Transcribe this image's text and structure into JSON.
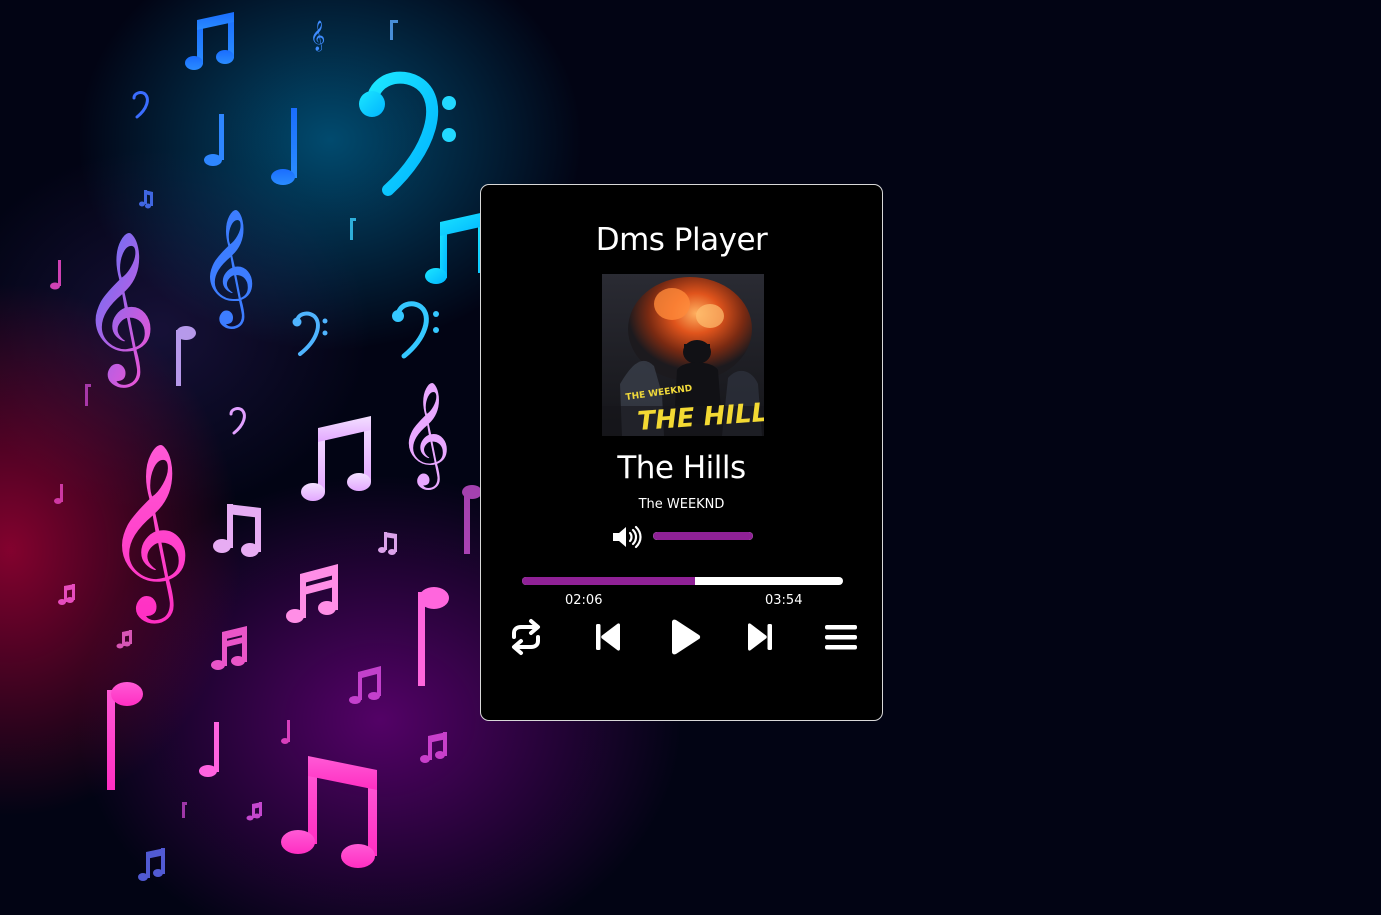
{
  "app": {
    "title": "Dms Player"
  },
  "track": {
    "title": "The Hills",
    "artist": "The WEEKND",
    "cover_text_top": "THE WEEKND",
    "cover_text_main": "THE HILLS"
  },
  "playback": {
    "current_time": "02:06",
    "total_time": "03:54",
    "progress_fraction": 0.538,
    "volume_fraction": 1.0
  },
  "icons": {
    "volume": "volume-icon",
    "repeat": "repeat-icon",
    "previous": "skip-previous-icon",
    "play": "play-icon",
    "next": "skip-next-icon",
    "playlist": "menu-icon"
  },
  "colors": {
    "accent": "#8f2196",
    "panel_bg": "#000000",
    "text": "#ffffff"
  }
}
